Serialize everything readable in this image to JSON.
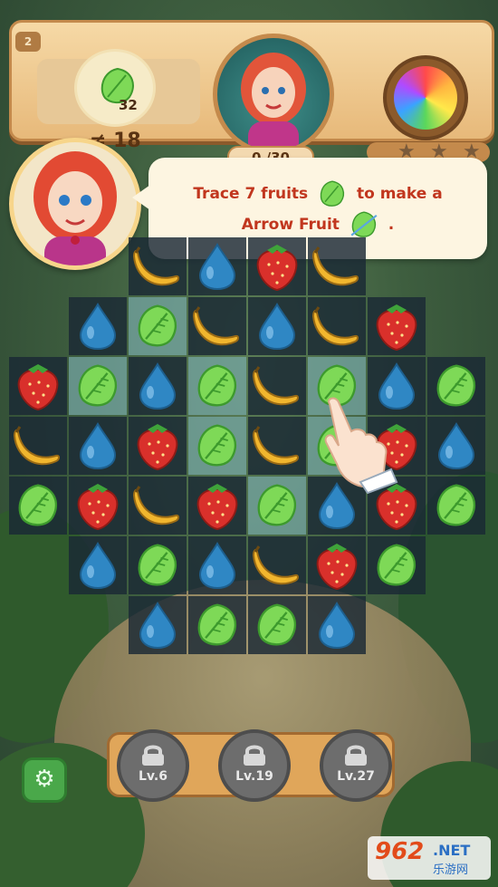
{
  "hud": {
    "level_tag": "2",
    "goal_count": "32",
    "moves": "≠ 18",
    "progress": "0 /30"
  },
  "tutorial": {
    "line1_part1": "Trace 7 fruits",
    "line1_part2": "to make a",
    "line2_part1": "Arrow Fruit",
    "line2_part2": "."
  },
  "board": {
    "columns": 8,
    "rows": 8,
    "cells": [
      [
        null,
        null,
        "banana",
        "drop",
        "strawberry",
        "banana",
        null,
        null
      ],
      [
        null,
        "drop",
        "leaf-hl",
        "banana",
        "drop",
        "banana",
        "strawberry",
        null
      ],
      [
        "strawberry",
        "leaf-hl",
        "drop",
        "leaf-hl",
        "banana",
        "leaf-hl",
        "drop",
        "leaf"
      ],
      [
        "banana",
        "drop",
        "strawberry",
        "leaf-hl",
        "banana",
        "leaf-hl",
        "strawberry",
        "drop"
      ],
      [
        "leaf",
        "strawberry",
        "banana",
        "strawberry",
        "leaf-hl",
        "drop",
        "strawberry",
        "leaf"
      ],
      [
        null,
        "drop",
        "leaf",
        "drop",
        "banana",
        "strawberry",
        "leaf",
        null
      ],
      [
        null,
        null,
        "drop",
        "leaf",
        "leaf",
        "drop",
        null,
        null
      ],
      [
        null,
        null,
        null,
        null,
        null,
        null,
        null,
        null
      ]
    ]
  },
  "locked_levels": [
    {
      "label": "Lv.6"
    },
    {
      "label": "Lv.19"
    },
    {
      "label": "Lv.27"
    }
  ],
  "watermark": {
    "number": "962",
    "net": ".NET",
    "sub": "乐游网"
  },
  "colors": {
    "leaf": "#7ed957",
    "drop": "#2f87c4",
    "strawberry": "#d9302b",
    "banana": "#f1b62e"
  }
}
